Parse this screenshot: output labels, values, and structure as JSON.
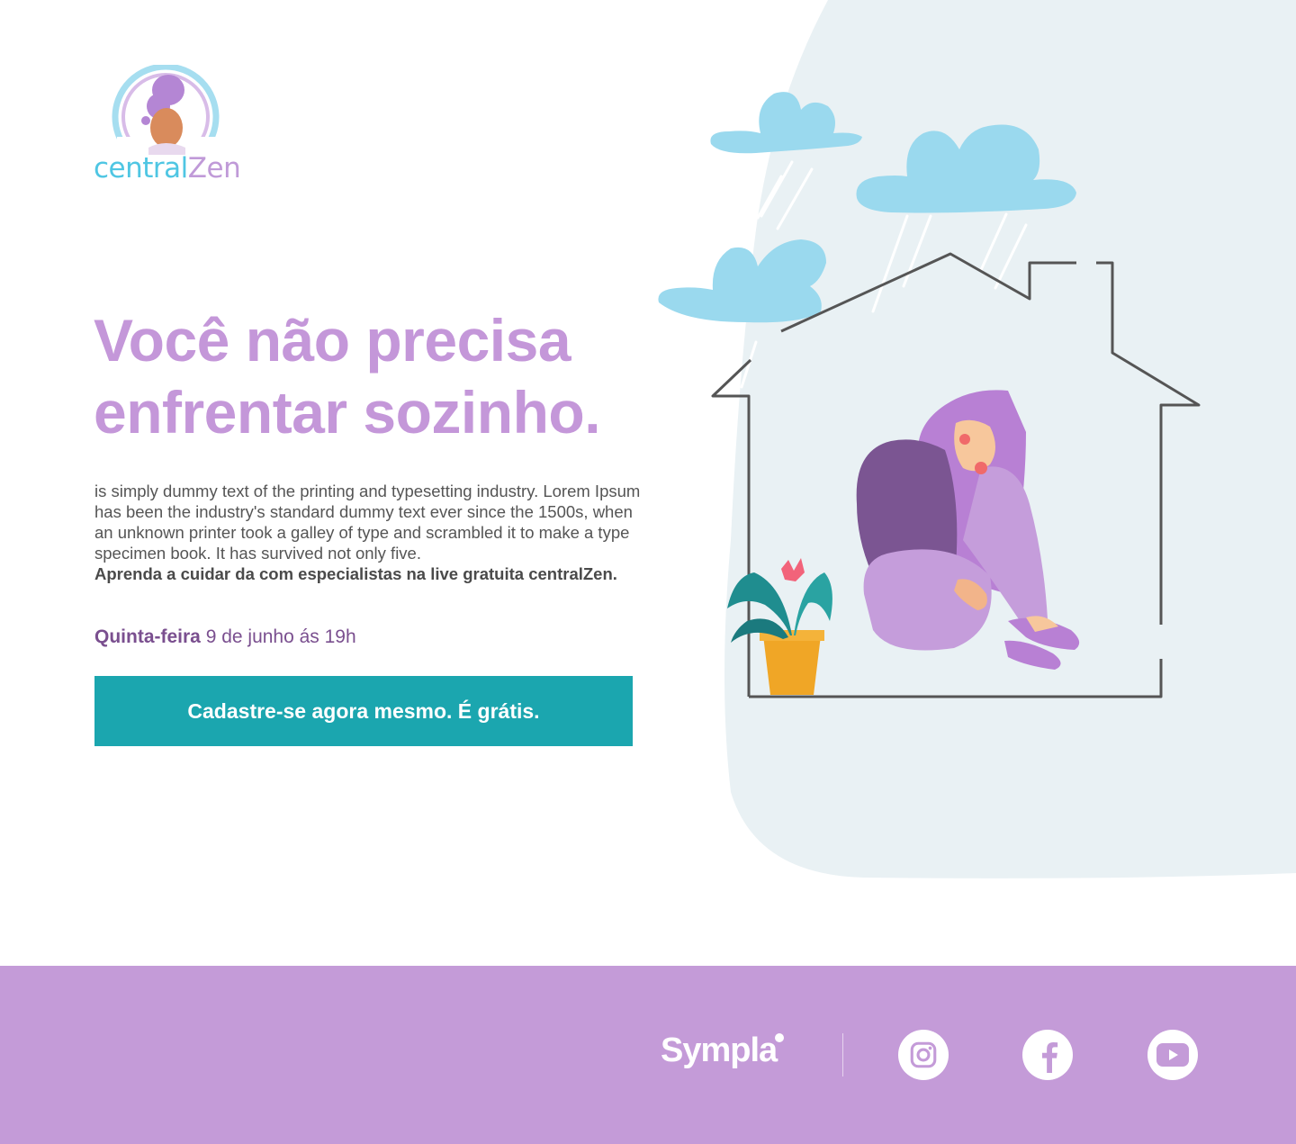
{
  "logo": {
    "part1": "central",
    "part2": "Zen"
  },
  "hero": {
    "headline_line1": "Você não precisa",
    "headline_line2": "enfrentar sozinho.",
    "description": "is simply dummy text of the printing and typesetting industry. Lorem Ipsum has been the industry's standard dummy text ever since the 1500s, when an unknown printer took a galley of type and scrambled it to make a type specimen book. It has survived not only five.",
    "description_bold": "Aprenda a cuidar da com especialistas na live gratuita centralZen.",
    "date_day": "Quinta-feira",
    "date_rest": " 9 de junho ás 19h",
    "cta_label": "Cadastre-se agora mesmo. É grátis."
  },
  "footer": {
    "brand": "Sympla",
    "social": [
      {
        "name": "instagram-icon"
      },
      {
        "name": "facebook-icon"
      },
      {
        "name": "youtube-icon"
      }
    ]
  },
  "colors": {
    "headline": "#c497d9",
    "cta": "#1ba6af",
    "footer": "#c49bd8",
    "accent_blue": "#4fc6e3",
    "blob": "#e9f1f4"
  }
}
